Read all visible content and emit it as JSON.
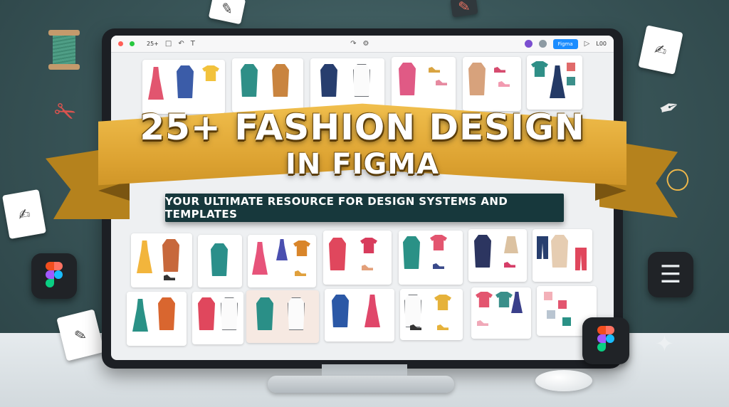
{
  "banner": {
    "title_line1": "25+ FASHION DESIGN",
    "title_line2": "IN FIGMA",
    "subtitle": "YOUR ULTIMATE RESOURCE FOR DESIGN SYSTEMS AND TEMPLATES"
  },
  "editor": {
    "zoom_label": "25+",
    "share_label": "Figma",
    "zoom_right_label": "L00"
  },
  "colors": {
    "background": "#3a5659",
    "ribbon": "#e4aa38",
    "ribbon_shadow": "#b5821d",
    "subtitle_bar": "#17383c",
    "share_button": "#1a8cff"
  },
  "icons": {
    "figma_logo": "figma-logo-icon",
    "layers": "layers-stack-icon",
    "scissors": "scissors-icon",
    "thread_spool": "thread-spool-icon",
    "pen_nib": "pen-nib-icon",
    "eyedropper": "eyedropper-icon",
    "sketchbook": "sketchbook-icon"
  }
}
